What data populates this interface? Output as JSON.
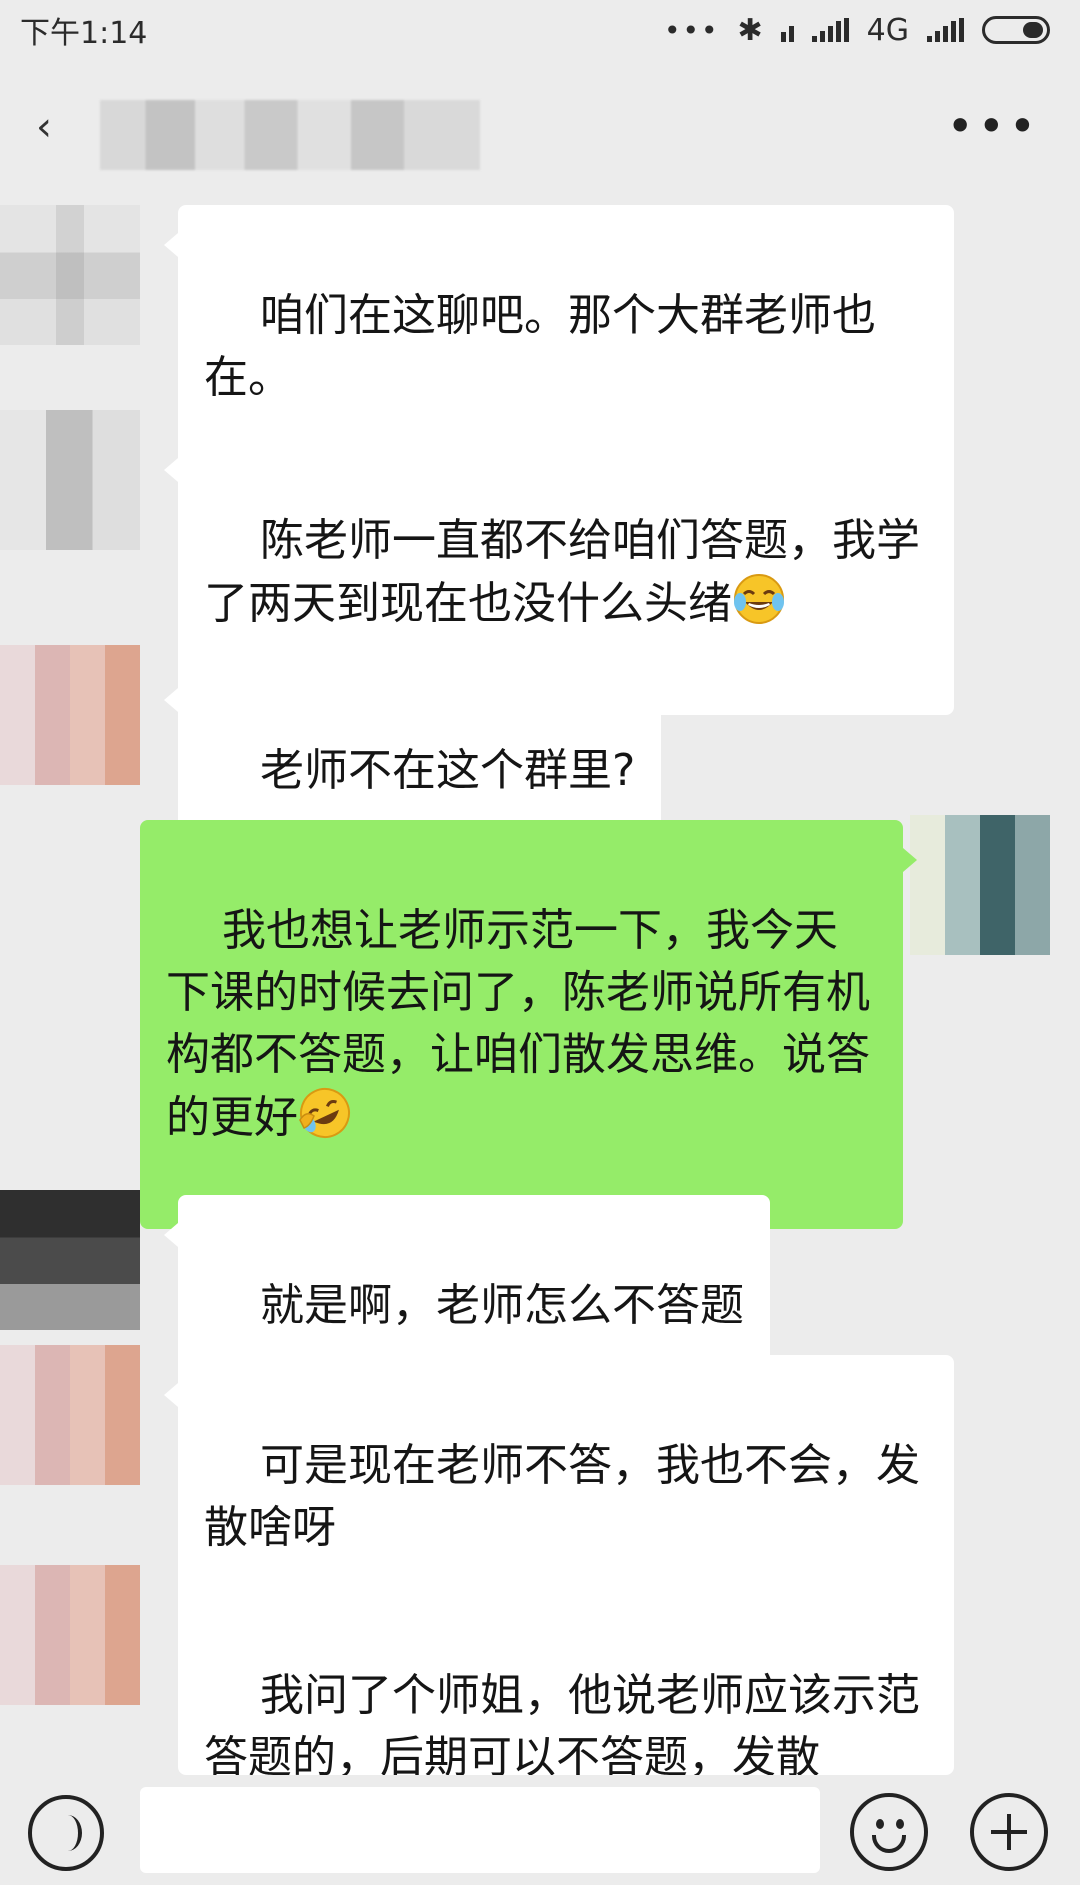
{
  "status_bar": {
    "time": "下午1:14",
    "network": "4G"
  },
  "header": {
    "back_icon": "back-chevron-icon",
    "more_icon": "more-dots-icon"
  },
  "messages": [
    {
      "direction": "in",
      "text": "咱们在这聊吧。那个大群老师也在。"
    },
    {
      "direction": "in",
      "text": "陈老师一直都不给咱们答题，我学了两天到现在也没什么头绪",
      "emoji": "tears-of-joy"
    },
    {
      "direction": "in",
      "text": "老师不在这个群里?"
    },
    {
      "direction": "out",
      "text": "我也想让老师示范一下，我今天下课的时候去问了，陈老师说所有机构都不答题，让咱们散发思维。说答的更好",
      "emoji": "rolling-laughing"
    },
    {
      "direction": "in",
      "text": "就是啊，老师怎么不答题"
    },
    {
      "direction": "in",
      "text": "可是现在老师不答，我也不会，发散啥呀"
    },
    {
      "direction": "in",
      "text": "我问了个师姐，他说老师应该示范答题的，后期可以不答题，发散"
    }
  ],
  "input_bar": {
    "voice_icon": "voice-icon",
    "emoji_icon": "smiley-icon",
    "plus_icon": "plus-icon",
    "input_value": ""
  }
}
